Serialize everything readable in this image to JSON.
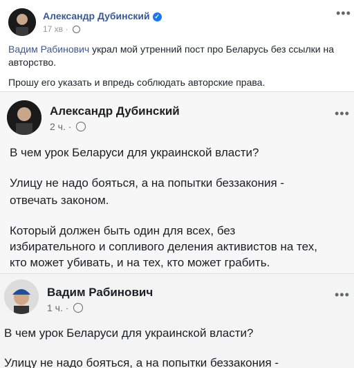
{
  "post": {
    "author": "Александр Дубинский",
    "time": "17 хв",
    "text_link": "Вадим Рабинович",
    "text_line1_rest": " украл мой утренний пост про Беларусь без ссылки на",
    "text_line2": "авторство.",
    "text_line3": "Прошу его указать и впредь соблюдать авторские права."
  },
  "screenshot1": {
    "author": "Александр Дубинский",
    "time": "2 ч.",
    "lines": [
      "В чем урок Беларуси для украинской власти?",
      "Улицу не надо бояться, а на попытки беззакония -",
      "отвечать законом.",
      "Который должен быть один для всех, без",
      "избирательного и сопливого деления активистов на тех,",
      "кто может убивать, и на тех, кто может грабить."
    ]
  },
  "screenshot2": {
    "author": "Вадим Рабинович",
    "time": "1 ч.",
    "lines": [
      "В чем урок Беларуси для украинской власти?",
      "Улицу не надо бояться, а на попытки беззакония -"
    ]
  },
  "colors": {
    "link": "#385898",
    "verified": "#1877f2",
    "meta": "#90949c"
  }
}
